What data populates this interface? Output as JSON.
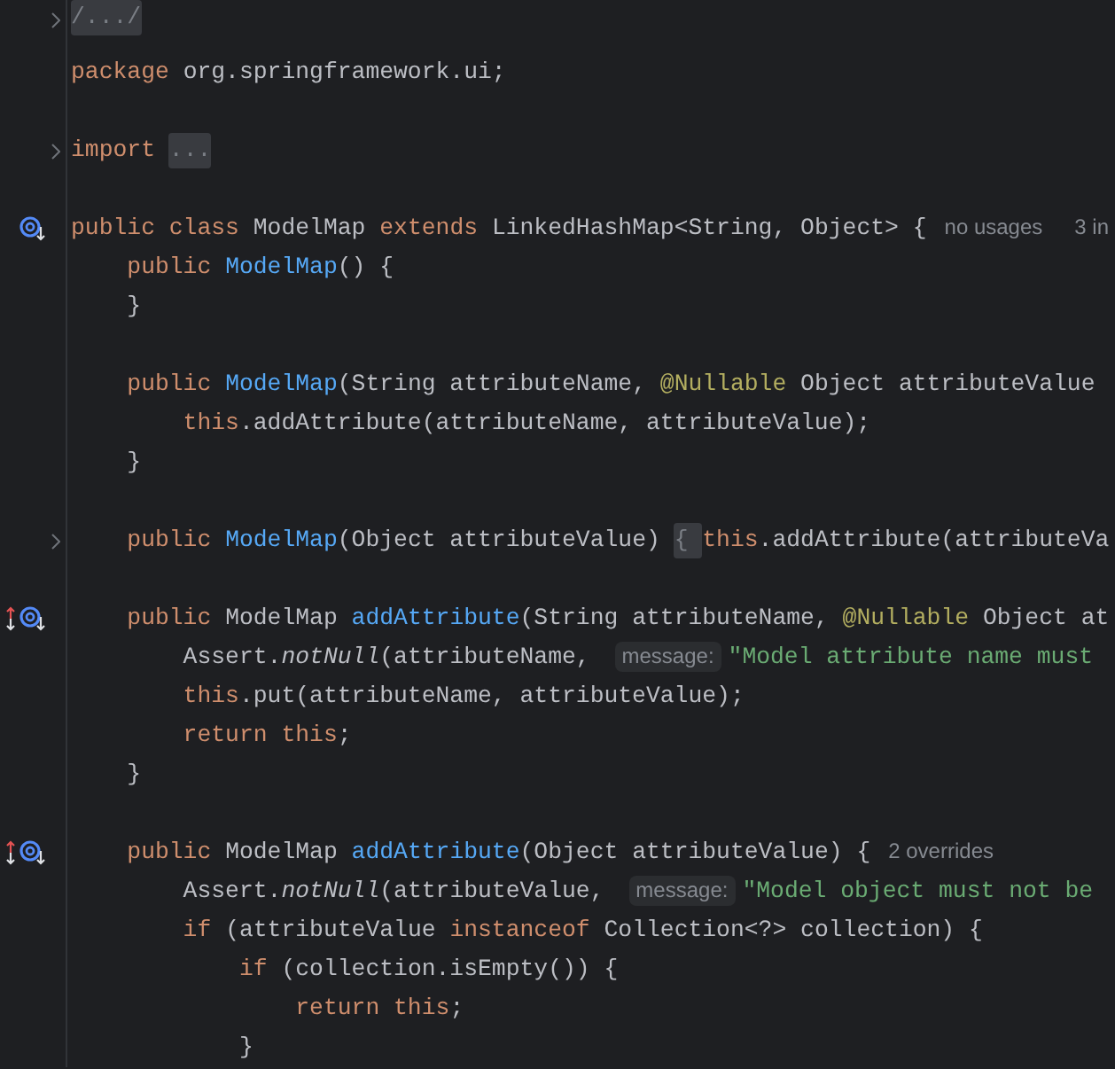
{
  "lines": [
    {
      "folded": true,
      "tokens": [
        {
          "kind": "fold",
          "text": "/.../"
        }
      ]
    },
    {
      "folded": false
    },
    {
      "folded": false,
      "tokens": [
        {
          "kind": "keyword",
          "text": "package "
        },
        {
          "kind": "plain",
          "text": "org.springframework.ui;"
        }
      ]
    },
    {
      "folded": false
    },
    {
      "folded": true,
      "tokens": [
        {
          "kind": "keyword",
          "text": "import "
        },
        {
          "kind": "fold",
          "text": "..."
        }
      ]
    },
    {
      "folded": false
    },
    {
      "folded": false,
      "markers": [
        {
          "kind": "implemented"
        }
      ],
      "tokens": [
        {
          "kind": "keyword",
          "text": "public class "
        },
        {
          "kind": "plain",
          "text": "ModelMap "
        },
        {
          "kind": "keyword",
          "text": "extends "
        },
        {
          "kind": "plain",
          "text": "LinkedHashMap<String, Object> {"
        },
        {
          "kind": "hint",
          "text": "no usages"
        },
        {
          "kind": "hint",
          "text": "3 in"
        }
      ]
    },
    {
      "folded": false,
      "tokens": [
        {
          "kind": "keyword",
          "text": "    public "
        },
        {
          "kind": "declaration",
          "text": "ModelMap"
        },
        {
          "kind": "plain",
          "text": "() {"
        }
      ]
    },
    {
      "folded": false,
      "tokens": [
        {
          "kind": "plain",
          "text": "    }"
        }
      ]
    },
    {
      "folded": false
    },
    {
      "folded": false,
      "tokens": [
        {
          "kind": "keyword",
          "text": "    public "
        },
        {
          "kind": "declaration",
          "text": "ModelMap"
        },
        {
          "kind": "plain",
          "text": "(String attributeName, "
        },
        {
          "kind": "annotation",
          "text": "@Nullable"
        },
        {
          "kind": "plain",
          "text": " Object attributeValue"
        }
      ]
    },
    {
      "folded": false,
      "tokens": [
        {
          "kind": "keyword",
          "text": "        this"
        },
        {
          "kind": "plain",
          "text": ".addAttribute(attributeName, attributeValue);"
        }
      ]
    },
    {
      "folded": false,
      "tokens": [
        {
          "kind": "plain",
          "text": "    }"
        }
      ]
    },
    {
      "folded": false
    },
    {
      "folded": true,
      "tokens": [
        {
          "kind": "keyword",
          "text": "    public "
        },
        {
          "kind": "declaration",
          "text": "ModelMap"
        },
        {
          "kind": "plain",
          "text": "(Object attributeValue) "
        },
        {
          "kind": "fold",
          "text": "{ "
        },
        {
          "kind": "keyword",
          "text": "this"
        },
        {
          "kind": "plain",
          "text": ".addAttribute(attributeVa"
        }
      ]
    },
    {
      "folded": false
    },
    {
      "folded": false,
      "markers": [
        {
          "kind": "overrides"
        },
        {
          "kind": "implemented"
        }
      ],
      "tokens": [
        {
          "kind": "keyword",
          "text": "    public "
        },
        {
          "kind": "plain",
          "text": "ModelMap "
        },
        {
          "kind": "declaration",
          "text": "addAttribute"
        },
        {
          "kind": "plain",
          "text": "(String attributeName, "
        },
        {
          "kind": "annotation",
          "text": "@Nullable"
        },
        {
          "kind": "plain",
          "text": " Object at"
        }
      ]
    },
    {
      "folded": false,
      "tokens": [
        {
          "kind": "plain",
          "text": "        Assert."
        },
        {
          "kind": "static-call",
          "text": "notNull"
        },
        {
          "kind": "plain",
          "text": "(attributeName, "
        },
        {
          "kind": "hint",
          "text": "message:"
        },
        {
          "kind": "string",
          "text": "\"Model attribute name must"
        }
      ]
    },
    {
      "folded": false,
      "tokens": [
        {
          "kind": "keyword",
          "text": "        this"
        },
        {
          "kind": "plain",
          "text": ".put(attributeName, attributeValue);"
        }
      ]
    },
    {
      "folded": false,
      "tokens": [
        {
          "kind": "keyword",
          "text": "        return this"
        },
        {
          "kind": "plain",
          "text": ";"
        }
      ]
    },
    {
      "folded": false,
      "tokens": [
        {
          "kind": "plain",
          "text": "    }"
        }
      ]
    },
    {
      "folded": false
    },
    {
      "folded": false,
      "markers": [
        {
          "kind": "overrides"
        },
        {
          "kind": "implemented"
        }
      ],
      "tokens": [
        {
          "kind": "keyword",
          "text": "    public "
        },
        {
          "kind": "plain",
          "text": "ModelMap "
        },
        {
          "kind": "declaration",
          "text": "addAttribute"
        },
        {
          "kind": "plain",
          "text": "(Object attributeValue) {"
        },
        {
          "kind": "hint",
          "text": "2 overrides"
        }
      ]
    },
    {
      "folded": false,
      "tokens": [
        {
          "kind": "plain",
          "text": "        Assert."
        },
        {
          "kind": "static-call",
          "text": "notNull"
        },
        {
          "kind": "plain",
          "text": "(attributeValue, "
        },
        {
          "kind": "hint",
          "text": "message:"
        },
        {
          "kind": "string",
          "text": "\"Model object must not be"
        }
      ]
    },
    {
      "folded": false,
      "tokens": [
        {
          "kind": "keyword",
          "text": "        if "
        },
        {
          "kind": "plain",
          "text": "(attributeValue "
        },
        {
          "kind": "keyword",
          "text": "instanceof "
        },
        {
          "kind": "plain",
          "text": "Collection<?> collection) {"
        }
      ]
    },
    {
      "folded": false,
      "tokens": [
        {
          "kind": "keyword",
          "text": "            if "
        },
        {
          "kind": "plain",
          "text": "(collection.isEmpty()) {"
        }
      ]
    },
    {
      "folded": false,
      "tokens": [
        {
          "kind": "keyword",
          "text": "                return this"
        },
        {
          "kind": "plain",
          "text": ";"
        }
      ]
    },
    {
      "folded": false,
      "tokens": [
        {
          "kind": "plain",
          "text": "            }"
        }
      ]
    }
  ]
}
